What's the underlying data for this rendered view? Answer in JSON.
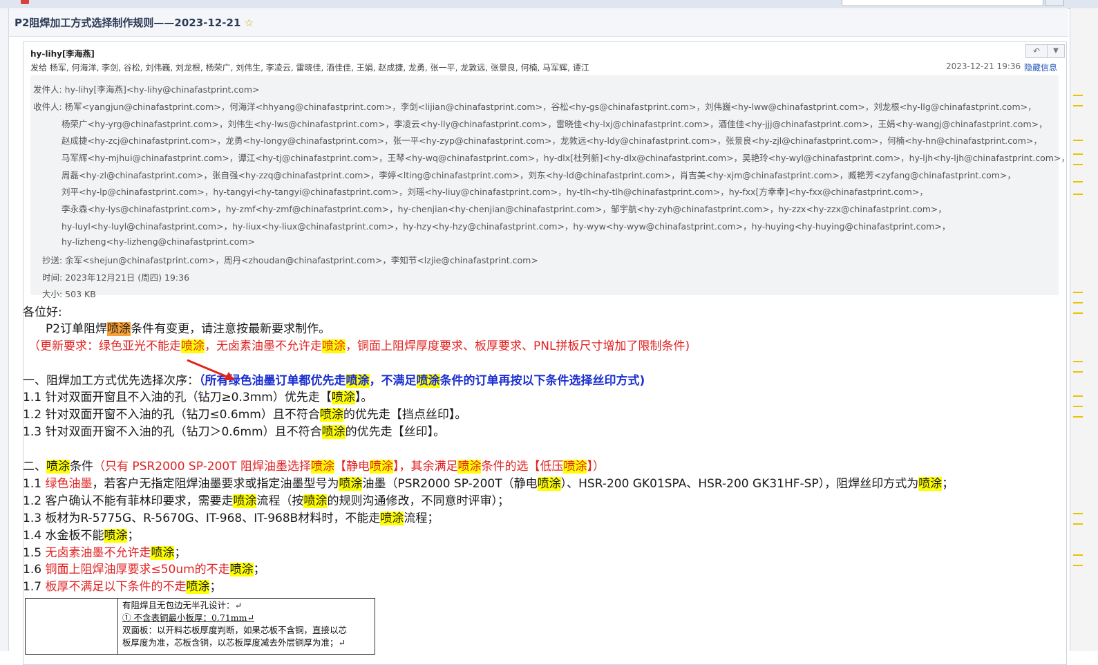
{
  "email": {
    "subject": "P2阻焊加工方式选择制作规则——2023-12-21",
    "star_icon": "star-icon",
    "sender": "hy-lihy[李海燕]",
    "recipients_line": "发给 杨军, 何海洋, 李剑, 谷松, 刘伟巍, 刘龙根, 杨荣广, 刘伟生, 李凌云, 雷晓佳, 酒佳佳, 王娟, 赵成捷, 龙勇, 张一平, 龙敦远, 张景良, 何楠, 马军辉, 谭江",
    "date": "2023-12-21 19:36",
    "hide_info": "隐藏信息",
    "reply_icon": "reply-icon",
    "more_icon": "chevron-down-icon"
  },
  "header": {
    "from": "发件人: hy-lihy[李海燕]<hy-lihy@chinafastprint.com>",
    "to_lines": [
      "收件人: 杨军<yangjun@chinafastprint.com>，何海洋<hhyang@chinafastprint.com>，李剑<lijian@chinafastprint.com>，谷松<hy-gs@chinafastprint.com>，刘伟巍<hy-lww@chinafastprint.com>，刘龙根<hy-llg@chinafastprint.com>，",
      "杨荣广<hy-yrg@chinafastprint.com>，刘伟生<hy-lws@chinafastprint.com>，李凌云<hy-lly@chinafastprint.com>，雷晓佳<hy-lxj@chinafastprint.com>，酒佳佳<hy-jjj@chinafastprint.com>，王娟<hy-wangj@chinafastprint.com>，",
      "赵成捷<hy-zcj@chinafastprint.com>，龙勇<hy-longy@chinafastprint.com>，张一平<hy-zyp@chinafastprint.com>，龙敦远<hy-ldy@chinafastprint.com>，张景良<hy-zjl@chinafastprint.com>，何楠<hy-hn@chinafastprint.com>，",
      "马军辉<hy-mjhui@chinafastprint.com>，谭江<hy-tj@chinafastprint.com>，王琴<hy-wq@chinafastprint.com>，hy-dlx[杜列新]<hy-dlx@chinafastprint.com>，吴艳玲<hy-wyl@chinafastprint.com>，hy-ljh<hy-ljh@chinafastprint.com>，",
      "周磊<hy-zl@chinafastprint.com>，张自强<hy-zzq@chinafastprint.com>，李婷<lting@chinafastprint.com>，刘东<hy-ld@chinafastprint.com>，肖吉美<hy-xjm@chinafastprint.com>，臧艳芳<zyfang@chinafastprint.com>，",
      "刘平<hy-lp@chinafastprint.com>，hy-tangyi<hy-tangyi@chinafastprint.com>，刘瑶<hy-liuy@chinafastprint.com>，hy-tlh<hy-tlh@chinafastprint.com>，hy-fxx[方幸幸]<hy-fxx@chinafastprint.com>，",
      "李永森<hy-lys@chinafastprint.com>，hy-zmf<hy-zmf@chinafastprint.com>，hy-chenjian<hy-chenjian@chinafastprint.com>，邹宇航<hy-zyh@chinafastprint.com>，hy-zzx<hy-zzx@chinafastprint.com>，",
      "hy-luyl<hy-luyl@chinafastprint.com>，hy-liux<hy-liux@chinafastprint.com>，hy-hzy<hy-hzy@chinafastprint.com>，hy-wyw<hy-wyw@chinafastprint.com>，hy-huying<hy-huying@chinafastprint.com>，",
      "hy-lizheng<hy-lizheng@chinafastprint.com>"
    ],
    "cc": "抄送: 余军<shejun@chinafastprint.com>，周丹<zhoudan@chinafastprint.com>，李知节<lzjie@chinafastprint.com>",
    "time": "时间: 2023年12月21日 (周四) 19:36",
    "size": "大小: 503 KB"
  },
  "body": {
    "greeting": "各位好:",
    "intro": {
      "a": "P2订单阻焊",
      "hl": "喷涂",
      "b": "条件有变更，请注意按最新要求制作。"
    },
    "update_note": {
      "p1": "（更新要求：绿色亚光不能走",
      "hl1": "喷涂",
      "p2": "，无卤素油墨不允许走",
      "hl2": "喷涂",
      "p3": "，铜面上阻焊厚度要求、板厚要求、PNL拼板尺寸增加了限制条件)"
    },
    "section1": {
      "title": "一、阻焊加工方式优先选择次序：",
      "blue_a": "（所有绿色油墨订单都优先走",
      "hl1": "喷涂",
      "blue_b": "，不满足",
      "hl2": "喷涂",
      "blue_c": "条件的订单再按以下条件选择丝印方式)"
    },
    "s1_items": [
      {
        "a": "1.1 针对双面开窗且不入油的孔（钻刀≥0.3mm）优先走【",
        "hl": "喷涂",
        "b": "】。"
      },
      {
        "a": "1.2 针对双面开窗不入油的孔（钻刀≤0.6mm）且不符合",
        "hl": "喷涂",
        "b": "的优先走【挡点丝印】。"
      },
      {
        "a": "1.3 针对双面开窗不入油的孔（钻刀＞0.6mm）且不符合",
        "hl": "喷涂",
        "b": "的优先走【丝印】。"
      }
    ],
    "section2": {
      "a": "二、",
      "hl1": "喷涂",
      "b": "条件",
      "red1": "（只有 PSR2000 SP-200T 阻焊油墨选择",
      "hl2": "喷涂",
      "red2": "【静电",
      "hl3": "喷涂",
      "red3": "】，其余满足",
      "hl4": "喷涂",
      "red4": "条件的选【低压",
      "hl5": "喷涂",
      "red5": "】）"
    },
    "s2_item1": {
      "a": "1.1 ",
      "red": "绿色油墨",
      "b": "，若客户无指定阻焊油墨要求或指定油墨型号为",
      "hl1": "喷涂",
      "c": "油墨（PSR2000 SP-200T（静电",
      "hl2": "喷涂",
      "d": "）、HSR-200 GK01SPA、HSR-200 GK31HF-SP），阻焊丝印方式为",
      "hl3": "喷涂",
      "e": "；"
    },
    "s2_item2": {
      "a": "1.2 客户确认不能有菲林印要求，需要走",
      "hl1": "喷涂",
      "b": "流程（按",
      "hl2": "喷涂",
      "c": "的规则沟通修改，不同意时评审）；"
    },
    "s2_item3": {
      "a": "1.3 板材为R-5775G、R-5670G、IT-968、IT-968B材料时，不能走",
      "hl": "喷涂",
      "b": "流程；"
    },
    "s2_item4": {
      "a": "1.4 水金板不能",
      "hl": "喷涂",
      "b": "；"
    },
    "s2_item5": {
      "a": "1.5 ",
      "red": "无卤素油墨不允许走",
      "hl": "喷涂",
      "b": "；"
    },
    "s2_item6": {
      "a": "1.6 ",
      "red": "铜面上阻焊油厚要求≤50um的不走",
      "hl": "喷涂",
      "b": "；"
    },
    "s2_item7": {
      "a": "1.7 ",
      "red": "板厚不满足以下条件的不走",
      "hl": "喷涂",
      "b": "；"
    },
    "table": [
      "有阻焊且无包边无半孔设计：↵",
      "①  不含表铜最小板厚：0.71mm↵",
      "双面板：以开料芯板厚度判断，如果芯板不含铜，直接以芯",
      "板厚度为准，芯板含铜，以芯板厚度减去外层铜厚为准；↵"
    ]
  }
}
